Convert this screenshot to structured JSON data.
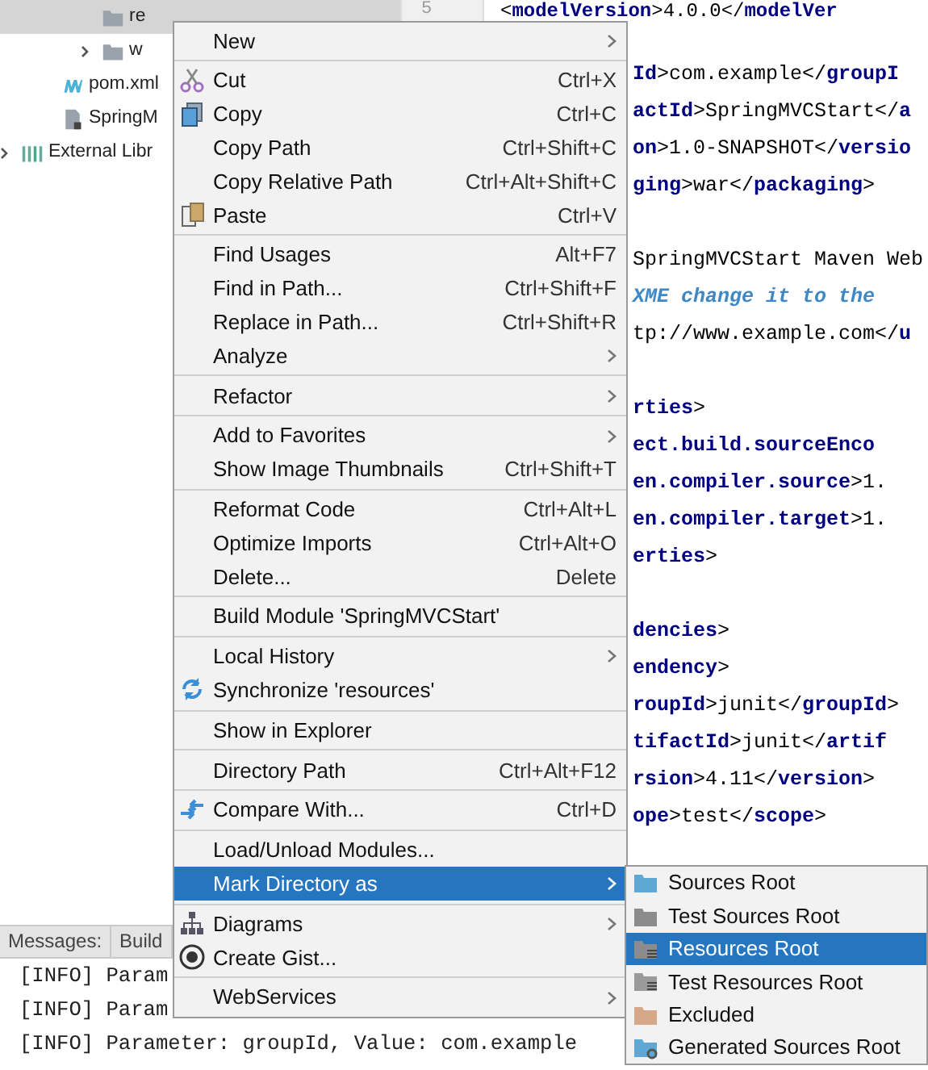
{
  "project_tree": {
    "gutter_number": "5",
    "nodes": [
      {
        "children": [
          {
            "children": [
              {
                "label": "re",
                "kind": "folder",
                "expandable": false,
                "selected": true
              },
              {
                "label": "w",
                "kind": "folder",
                "expandable": true,
                "selected": false
              }
            ]
          },
          {
            "label": "pom.xml",
            "kind": "maven",
            "expandable": false,
            "selected": false
          },
          {
            "label": "SpringM",
            "kind": "file",
            "expandable": false,
            "selected": false
          }
        ]
      },
      {
        "label": "External Libr",
        "kind": "library",
        "expandable": true,
        "selected": false
      }
    ]
  },
  "editor": {
    "first_line": "<**modelVersion**>4.0.0</**modelVer**",
    "lines": [
      {
        "kind": "blank"
      },
      {
        "text": "**Id**>com.example</**groupI**",
        "kind": "code"
      },
      {
        "text": "**actId**>SpringMVCStart</**a**",
        "kind": "code"
      },
      {
        "text": "**on**>1.0-SNAPSHOT</**versio**",
        "kind": "code"
      },
      {
        "text": "**ging**>war</**packaging**>",
        "kind": "code"
      },
      {
        "kind": "blank"
      },
      {
        "text": "SpringMVCStart Maven Web",
        "kind": "code"
      },
      {
        "text": "XME change it to the",
        "kind": "comment"
      },
      {
        "text": "tp://www.example.com</**u**",
        "kind": "code"
      },
      {
        "kind": "blank"
      },
      {
        "text": "**rties**>",
        "kind": "code"
      },
      {
        "text": "**ect.build.sourceEnco**",
        "kind": "code"
      },
      {
        "text": "**en.compiler.source**>1.",
        "kind": "code"
      },
      {
        "text": "**en.compiler.target**>1.",
        "kind": "code"
      },
      {
        "text": "**erties**>",
        "kind": "code"
      },
      {
        "kind": "blank"
      },
      {
        "text": "**dencies**>",
        "kind": "code"
      },
      {
        "text": "**endency**>",
        "kind": "code"
      },
      {
        "text": "**roupId**>junit</**groupId**>",
        "kind": "code"
      },
      {
        "text": "**tifactId**>junit</**artif**",
        "kind": "code"
      },
      {
        "text": "**rsion**>4.11</**version**>",
        "kind": "code"
      },
      {
        "text": "**ope**>test</**scope**>",
        "kind": "code"
      }
    ]
  },
  "bottom_panel": {
    "tabs": [
      {
        "label": "Messages:",
        "selected": false
      },
      {
        "label": "Build",
        "selected": false
      }
    ],
    "lines": [
      "[INFO] Param",
      "[INFO] Param",
      "[INFO] Parameter: groupId, Value: com.example"
    ]
  },
  "context_menu": {
    "groups": [
      [
        {
          "label": "New",
          "kind": "plain",
          "submenu": true,
          "selected": false
        }
      ],
      [
        {
          "label": "Cut",
          "shortcut": "Ctrl+X",
          "kind": "cut",
          "submenu": false,
          "selected": false
        },
        {
          "label": "Copy",
          "shortcut": "Ctrl+C",
          "kind": "copy",
          "submenu": false,
          "selected": false
        },
        {
          "label": "Copy Path",
          "shortcut": "Ctrl+Shift+C",
          "kind": "plain",
          "submenu": false,
          "selected": false
        },
        {
          "label": "Copy Relative Path",
          "shortcut": "Ctrl+Alt+Shift+C",
          "kind": "plain",
          "submenu": false,
          "selected": false
        },
        {
          "label": "Paste",
          "shortcut": "Ctrl+V",
          "kind": "paste",
          "submenu": false,
          "selected": false
        }
      ],
      [
        {
          "label": "Find Usages",
          "shortcut": "Alt+F7",
          "kind": "plain",
          "submenu": false,
          "selected": false
        },
        {
          "label": "Find in Path...",
          "shortcut": "Ctrl+Shift+F",
          "kind": "plain",
          "submenu": false,
          "selected": false
        },
        {
          "label": "Replace in Path...",
          "shortcut": "Ctrl+Shift+R",
          "kind": "plain",
          "submenu": false,
          "selected": false
        },
        {
          "label": "Analyze",
          "kind": "plain",
          "submenu": true,
          "selected": false
        }
      ],
      [
        {
          "label": "Refactor",
          "kind": "plain",
          "submenu": true,
          "selected": false
        }
      ],
      [
        {
          "label": "Add to Favorites",
          "kind": "plain",
          "submenu": true,
          "selected": false
        },
        {
          "label": "Show Image Thumbnails",
          "shortcut": "Ctrl+Shift+T",
          "kind": "plain",
          "submenu": false,
          "selected": false
        }
      ],
      [
        {
          "label": "Reformat Code",
          "shortcut": "Ctrl+Alt+L",
          "kind": "plain",
          "submenu": false,
          "selected": false
        },
        {
          "label": "Optimize Imports",
          "shortcut": "Ctrl+Alt+O",
          "kind": "plain",
          "submenu": false,
          "selected": false
        },
        {
          "label": "Delete...",
          "shortcut": "Delete",
          "kind": "plain",
          "submenu": false,
          "selected": false
        }
      ],
      [
        {
          "label": "Build Module 'SpringMVCStart'",
          "kind": "plain",
          "submenu": false,
          "selected": false
        }
      ],
      [
        {
          "label": "Local History",
          "kind": "plain",
          "submenu": true,
          "selected": false
        },
        {
          "label": "Synchronize 'resources'",
          "kind": "sync",
          "submenu": false,
          "selected": false
        }
      ],
      [
        {
          "label": "Show in Explorer",
          "kind": "plain",
          "submenu": false,
          "selected": false
        }
      ],
      [
        {
          "label": "Directory Path",
          "shortcut": "Ctrl+Alt+F12",
          "kind": "plain",
          "submenu": false,
          "selected": false
        }
      ],
      [
        {
          "label": "Compare With...",
          "shortcut": "Ctrl+D",
          "kind": "compare",
          "submenu": false,
          "selected": false
        }
      ],
      [
        {
          "label": "Load/Unload Modules...",
          "kind": "plain",
          "submenu": false,
          "selected": false
        },
        {
          "label": "Mark Directory as",
          "kind": "plain",
          "submenu": true,
          "selected": true
        }
      ],
      [
        {
          "label": "Diagrams",
          "kind": "diagram",
          "submenu": true,
          "selected": false
        },
        {
          "label": "Create Gist...",
          "kind": "gist",
          "submenu": false,
          "selected": false
        }
      ],
      [
        {
          "label": "WebServices",
          "kind": "plain",
          "submenu": true,
          "selected": false
        }
      ]
    ]
  },
  "submenu": {
    "items": [
      {
        "label": "Sources Root",
        "kind": "folder",
        "color": "#5fa8d3",
        "selected": false
      },
      {
        "label": "Test Sources Root",
        "kind": "folder",
        "color": "#8c8c8c",
        "selected": false
      },
      {
        "label": "Resources Root",
        "kind": "lines",
        "color": "#8c8c8c",
        "selected": true
      },
      {
        "label": "Test Resources Root",
        "kind": "lines",
        "color": "#9a9a9a",
        "selected": false
      },
      {
        "label": "Excluded",
        "kind": "folder",
        "color": "#d6a88a",
        "selected": false
      },
      {
        "label": "Generated Sources Root",
        "kind": "gear",
        "color": "#5fa8d3",
        "selected": false
      }
    ]
  }
}
